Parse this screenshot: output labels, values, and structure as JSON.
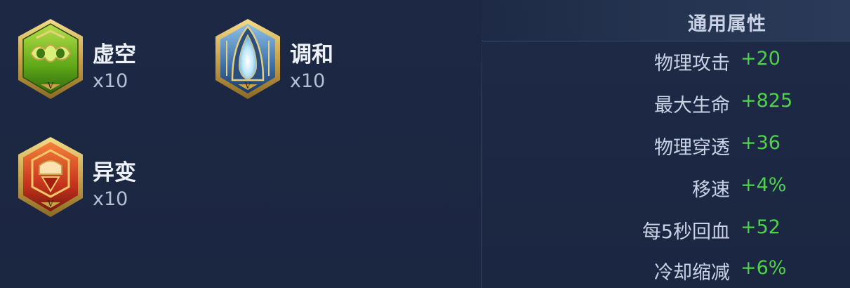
{
  "runes": [
    {
      "name": "虚空",
      "count": "x10",
      "color": "green"
    },
    {
      "name": "调和",
      "count": "x10",
      "color": "blue"
    },
    {
      "name": "异变",
      "count": "x10",
      "color": "red"
    }
  ],
  "stats": {
    "title": "通用属性",
    "rows": [
      {
        "label": "物理攻击",
        "value": "+20"
      },
      {
        "label": "最大生命",
        "value": "+825"
      },
      {
        "label": "物理穿透",
        "value": "+36"
      },
      {
        "label": "移速",
        "value": "+4%"
      },
      {
        "label": "每5秒回血",
        "value": "+52"
      },
      {
        "label": "冷却缩减",
        "value": "+6%"
      }
    ]
  },
  "colors": {
    "background": "#1c2742",
    "value_green": "#4fd24a",
    "gold_frame": "#c9a24a",
    "rune_green": "#5fa818",
    "rune_blue": "#3c6fa8",
    "rune_red": "#c8341e"
  }
}
